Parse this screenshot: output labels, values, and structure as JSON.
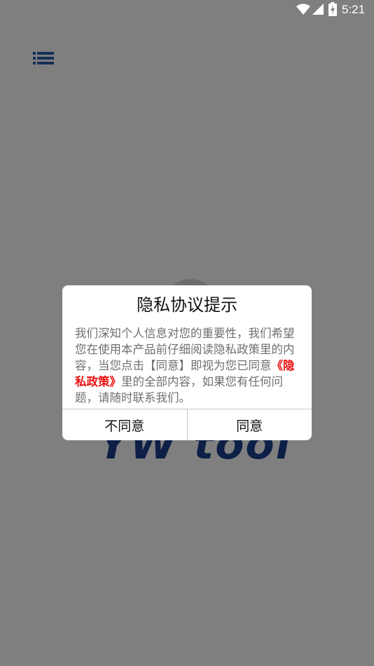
{
  "status_bar": {
    "time": "5:21"
  },
  "app": {
    "logo_text": "YW tool",
    "icons": {
      "menu": "menu-icon"
    }
  },
  "dialog": {
    "title": "隐私协议提示",
    "body_before": "我们深知个人信息对您的重要性，我们希望您在使用本产品前仔细阅读隐私政策里的内容，当您点击【同意】即视为您已同意",
    "policy_link": "《隐私政策》",
    "body_after": "里的全部内容，如果您有任何问题，请随时联系我们。",
    "disagree_label": "不同意",
    "agree_label": "同意"
  },
  "colors": {
    "scrim": "#808080",
    "link": "#ee1111",
    "logo": "#1a3f8c",
    "menu_icon": "#2a5fb0"
  }
}
